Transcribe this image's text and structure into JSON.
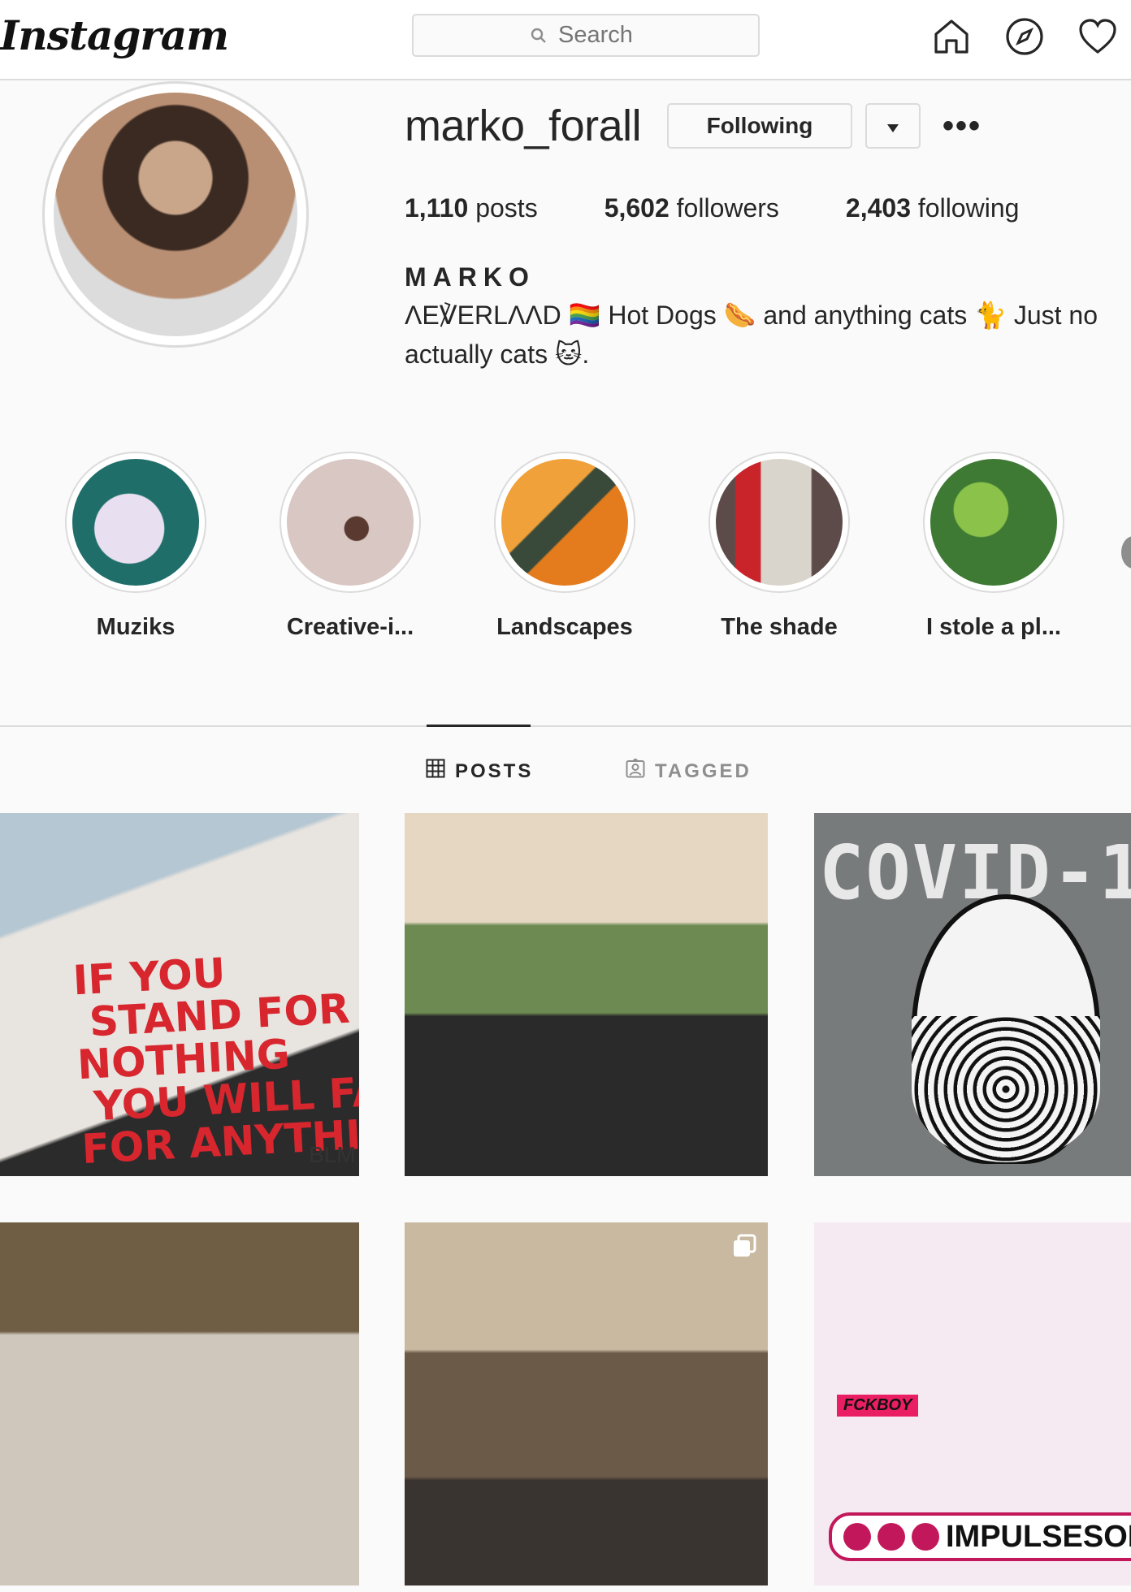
{
  "header": {
    "logo": "Instagram",
    "search_placeholder": "Search",
    "icons": [
      "home-icon",
      "explore-icon",
      "activity-heart-icon"
    ]
  },
  "profile": {
    "username": "marko_forall",
    "following_button": "Following",
    "dropdown_icon": "▾",
    "more_label": "•••",
    "stats": {
      "posts_count": "1,110",
      "posts_label": " posts",
      "followers_count": "5,602",
      "followers_label": " followers",
      "following_count": "2,403",
      "following_label": " following"
    },
    "full_name": "MARKO",
    "bio_line1": "ΛΕ℣ERLΛΛD 🏳️‍🌈 Hot Dogs 🌭 and anything cats 🐈 Just no",
    "bio_line2": "actually cats 🐱."
  },
  "highlights": [
    {
      "label": "Muziks",
      "color": "#1f6e6a"
    },
    {
      "label": "Creative-i...",
      "color": "#d8c7c3"
    },
    {
      "label": "Landscapes",
      "color": "#e47c1e"
    },
    {
      "label": "The shade",
      "color": "#5d4b49"
    },
    {
      "label": "I stole a pl...",
      "color": "#3f7a35"
    }
  ],
  "tabs": {
    "posts": "POSTS",
    "tagged": "TAGGED"
  },
  "posts": {
    "p1_text": "IF YOU\n STAND FOR\nNOTHING\n YOU WILL FAI\nFOR ANYTHI",
    "p1_sign": "BLM",
    "p3_text": "COVID-1",
    "p6_shirt": "FCKBOY",
    "p6_brand": "IMPULSESOF"
  },
  "colors": {
    "accent_text": "#262626",
    "muted": "#8e8e8e",
    "border": "#dbdbdb",
    "background": "#fafafa"
  }
}
